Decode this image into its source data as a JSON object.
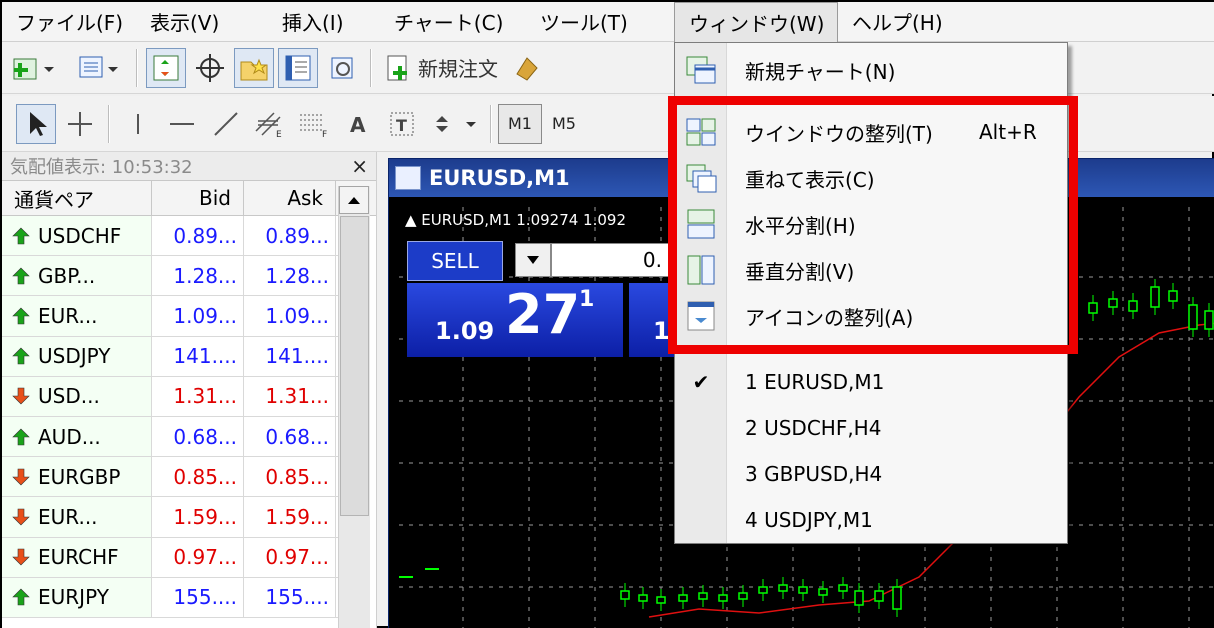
{
  "menubar": {
    "items": [
      {
        "label": "ファイル(F)"
      },
      {
        "label": "表示(V)"
      },
      {
        "label": "挿入(I)"
      },
      {
        "label": "チャート(C)"
      },
      {
        "label": "ツール(T)"
      },
      {
        "label": "ウィンドウ(W)"
      },
      {
        "label": "ヘルプ(H)"
      }
    ]
  },
  "toolbar1": {
    "new_order_label": "新規注文"
  },
  "toolbar2": {
    "timeframes": [
      "M1",
      "M5"
    ]
  },
  "market_watch": {
    "title": "気配値表示: 10:53:32",
    "close_glyph": "×",
    "columns": {
      "symbol": "通貨ペア",
      "bid": "Bid",
      "ask": "Ask"
    },
    "rows": [
      {
        "symbol": "USDCHF",
        "bid": "0.89...",
        "ask": "0.89...",
        "dir": "up"
      },
      {
        "symbol": "GBP...",
        "bid": "1.28...",
        "ask": "1.28...",
        "dir": "up"
      },
      {
        "symbol": "EUR...",
        "bid": "1.09...",
        "ask": "1.09...",
        "dir": "up"
      },
      {
        "symbol": "USDJPY",
        "bid": "141....",
        "ask": "141....",
        "dir": "up"
      },
      {
        "symbol": "USD...",
        "bid": "1.31...",
        "ask": "1.31...",
        "dir": "down"
      },
      {
        "symbol": "AUD...",
        "bid": "0.68...",
        "ask": "0.68...",
        "dir": "up"
      },
      {
        "symbol": "EURGBP",
        "bid": "0.85...",
        "ask": "0.85...",
        "dir": "down"
      },
      {
        "symbol": "EUR...",
        "bid": "1.59...",
        "ask": "1.59...",
        "dir": "down"
      },
      {
        "symbol": "EURCHF",
        "bid": "0.97...",
        "ask": "0.97...",
        "dir": "down"
      },
      {
        "symbol": "EURJPY",
        "bid": "155....",
        "ask": "155....",
        "dir": "up"
      }
    ],
    "colors": {
      "up_text": "#1a1aff",
      "down_text": "#e00000",
      "up_arrow": "#1aa31a",
      "down_arrow": "#e8501a"
    }
  },
  "chart": {
    "title": "EURUSD,M1",
    "info": "▲ EURUSD,M1  1.09274 1.092",
    "sell_label": "SELL",
    "lot_value": "0.",
    "price_prefix": "1.09",
    "price_main": "27",
    "price_sup": "1",
    "price2_prefix": "1"
  },
  "window_menu": {
    "items": [
      {
        "label": "新規チャート(N)",
        "shortcut": "",
        "icon": "new-chart-icon"
      },
      {
        "label": "ウインドウの整列(T)",
        "shortcut": "Alt+R",
        "icon": "tile-windows-icon"
      },
      {
        "label": "重ねて表示(C)",
        "shortcut": "",
        "icon": "cascade-icon"
      },
      {
        "label": "水平分割(H)",
        "shortcut": "",
        "icon": "tile-horizontal-icon"
      },
      {
        "label": "垂直分割(V)",
        "shortcut": "",
        "icon": "tile-vertical-icon"
      },
      {
        "label": "アイコンの整列(A)",
        "shortcut": "",
        "icon": "arrange-icons-icon"
      },
      {
        "label": "1 EURUSD,M1",
        "shortcut": "",
        "checked": true
      },
      {
        "label": "2 USDCHF,H4",
        "shortcut": ""
      },
      {
        "label": "3 GBPUSD,H4",
        "shortcut": ""
      },
      {
        "label": "4 USDJPY,M1",
        "shortcut": ""
      }
    ],
    "highlight_color": "#ee0000"
  }
}
